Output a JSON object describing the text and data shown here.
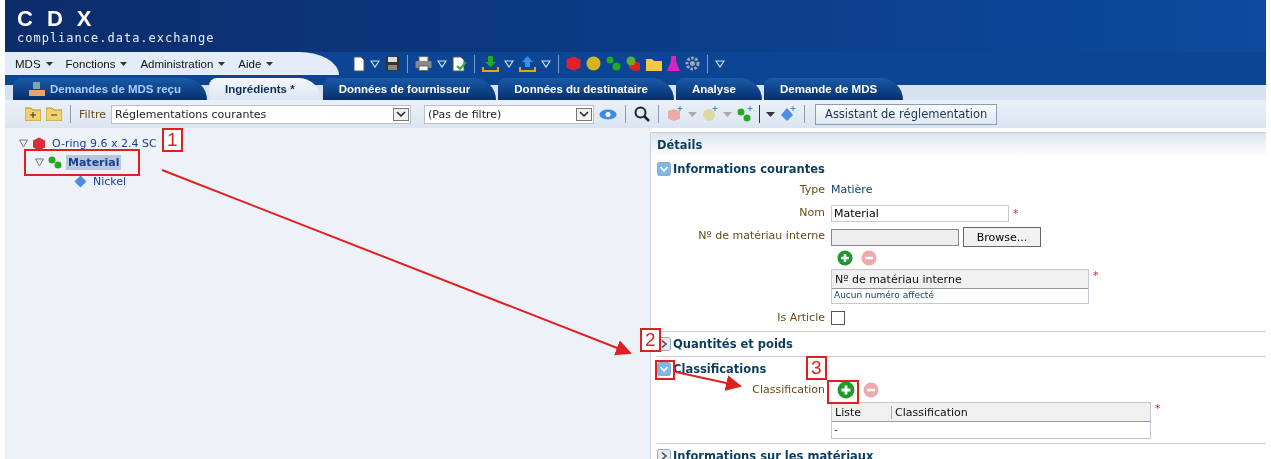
{
  "header": {
    "logo_text": "CDX",
    "tagline": "compliance.data.exchange"
  },
  "menu": [
    {
      "label": "MDS"
    },
    {
      "label": "Fonctions"
    },
    {
      "label": "Administration"
    },
    {
      "label": "Aide"
    }
  ],
  "tabs": [
    {
      "label": "Demandes de MDS reçu",
      "selected": false,
      "has_icon": true
    },
    {
      "label": "Ingrédients *",
      "selected": true,
      "has_icon": false
    },
    {
      "label": "Données de fournisseur",
      "selected": false,
      "has_icon": false
    },
    {
      "label": "Données du destinataire",
      "selected": false,
      "has_icon": false
    },
    {
      "label": "Analyse",
      "selected": false,
      "has_icon": false
    },
    {
      "label": "Demande de MDS",
      "selected": false,
      "has_icon": false
    }
  ],
  "filter_bar": {
    "label": "Filtre",
    "filter_value": "Réglementations courantes",
    "second_filter_value": "(Pas de filtre)",
    "assistant_button": "Assistant de réglementation"
  },
  "tree": [
    {
      "label": "O-ring 9.6 x 2.4 SC",
      "kind": "part",
      "expanded": true,
      "selected": false,
      "children": [
        {
          "label": "Material",
          "kind": "material",
          "expanded": true,
          "selected": true,
          "children": [
            {
              "label": "Nickel",
              "kind": "substance",
              "selected": false
            }
          ]
        }
      ]
    }
  ],
  "details": {
    "title": "Détails",
    "current_info": {
      "title": "Informations courantes",
      "expanded": true,
      "type_label": "Type",
      "type_value": "Matière",
      "name_label": "Nom",
      "name_value": "Material",
      "required_mark": "*",
      "internal_no_label": "Nº de matériau interne",
      "browse_button": "Browse...",
      "list_header": "Nº de matériau interne",
      "list_required_mark": "*",
      "list_empty": "Aucun numéro affecté",
      "is_article_label": "Is Article",
      "is_article_checked": false
    },
    "quantities": {
      "title": "Quantités et poids",
      "expanded": false
    },
    "classifications": {
      "title": "Classifications",
      "expanded": true,
      "label": "Classification",
      "columns": [
        "Liste",
        "Classification"
      ],
      "required_mark": "*",
      "empty_row": "-"
    },
    "material_info": {
      "title": "Informations sur les matériaux",
      "expanded": false
    }
  },
  "annotations": [
    {
      "number": "1"
    },
    {
      "number": "2"
    },
    {
      "number": "3"
    }
  ]
}
